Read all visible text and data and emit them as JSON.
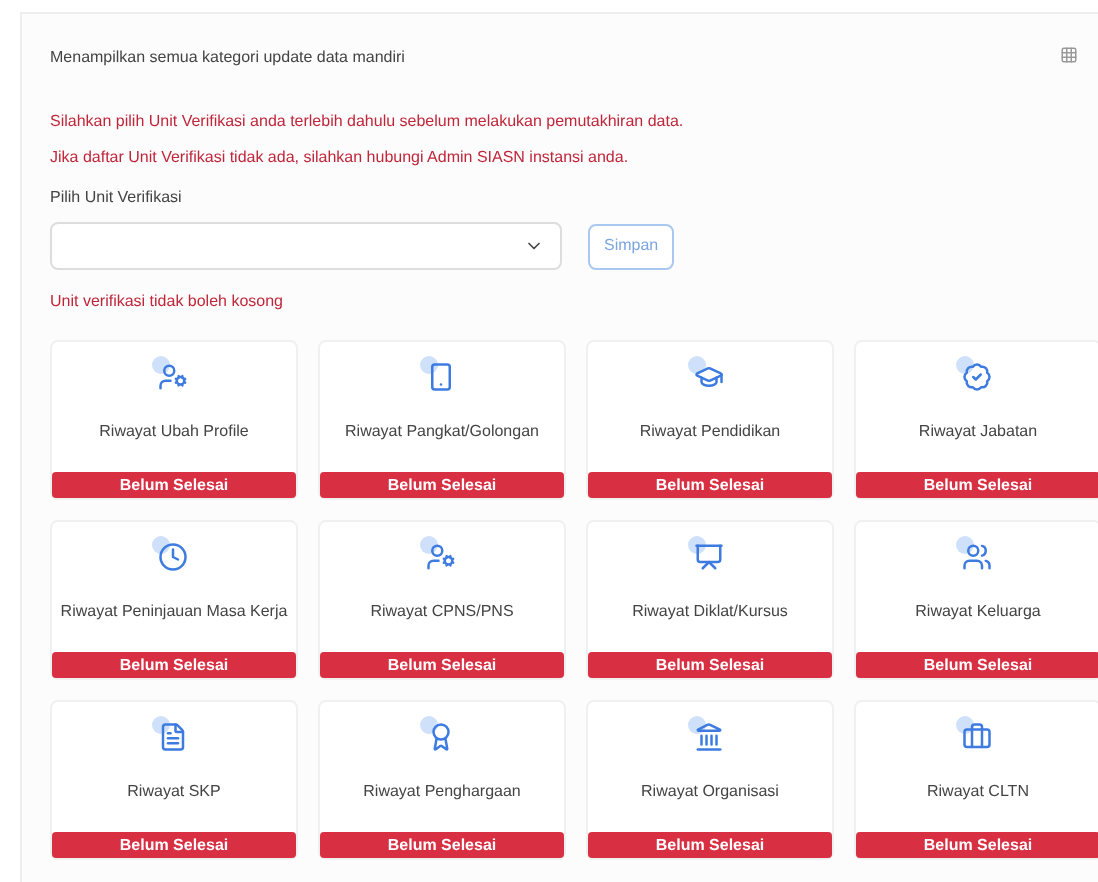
{
  "header": {
    "title": "Menampilkan semua kategori update data mandiri"
  },
  "notices": [
    "Silahkan pilih Unit Verifikasi anda terlebih dahulu sebelum melakukan pemutakhiran data.",
    "Jika daftar Unit Verifikasi tidak ada, silahkan hubungi Admin SIASN instansi anda."
  ],
  "unit_field": {
    "label": "Pilih Unit Verifikasi",
    "error": "Unit verifikasi tidak boleh kosong"
  },
  "save_button": "Simpan",
  "categories": [
    {
      "title": "Riwayat Ubah Profile",
      "status": "Belum Selesai"
    },
    {
      "title": "Riwayat Pangkat/Golongan",
      "status": "Belum Selesai"
    },
    {
      "title": "Riwayat Pendidikan",
      "status": "Belum Selesai"
    },
    {
      "title": "Riwayat Jabatan",
      "status": "Belum Selesai"
    },
    {
      "title": "Riwayat Peninjauan Masa Kerja",
      "status": "Belum Selesai"
    },
    {
      "title": "Riwayat CPNS/PNS",
      "status": "Belum Selesai"
    },
    {
      "title": "Riwayat Diklat/Kursus",
      "status": "Belum Selesai"
    },
    {
      "title": "Riwayat Keluarga",
      "status": "Belum Selesai"
    },
    {
      "title": "Riwayat SKP",
      "status": "Belum Selesai"
    },
    {
      "title": "Riwayat Penghargaan",
      "status": "Belum Selesai"
    },
    {
      "title": "Riwayat Organisasi",
      "status": "Belum Selesai"
    },
    {
      "title": "Riwayat CLTN",
      "status": "Belum Selesai"
    }
  ]
}
